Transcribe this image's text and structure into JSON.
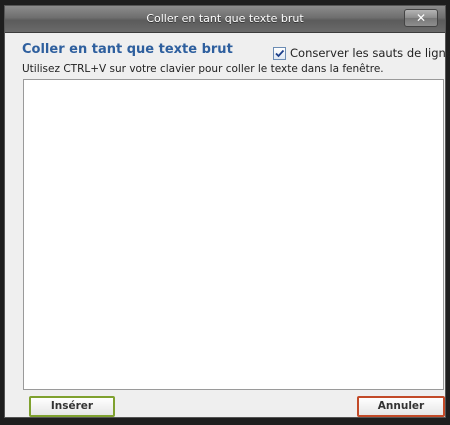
{
  "dialog": {
    "title": "Coller en tant que texte brut",
    "close_label": "✕",
    "heading": "Coller en tant que texte brut",
    "preserve_linebreaks": {
      "label": "Conserver les sauts de ligne",
      "checked": true
    },
    "instruction": "Utilisez CTRL+V sur votre clavier pour coller le texte dans la fenêtre.",
    "paste_area": {
      "value": ""
    },
    "buttons": {
      "insert_label": "Insérer",
      "cancel_label": "Annuler"
    }
  },
  "colors": {
    "heading": "#2e5f9e",
    "insert_border": "#7fa12f",
    "cancel_border": "#c24a28",
    "titlebar": "#6e6e6e"
  },
  "icons": {
    "close": "close-icon",
    "checkbox_check": "checkmark-icon"
  }
}
